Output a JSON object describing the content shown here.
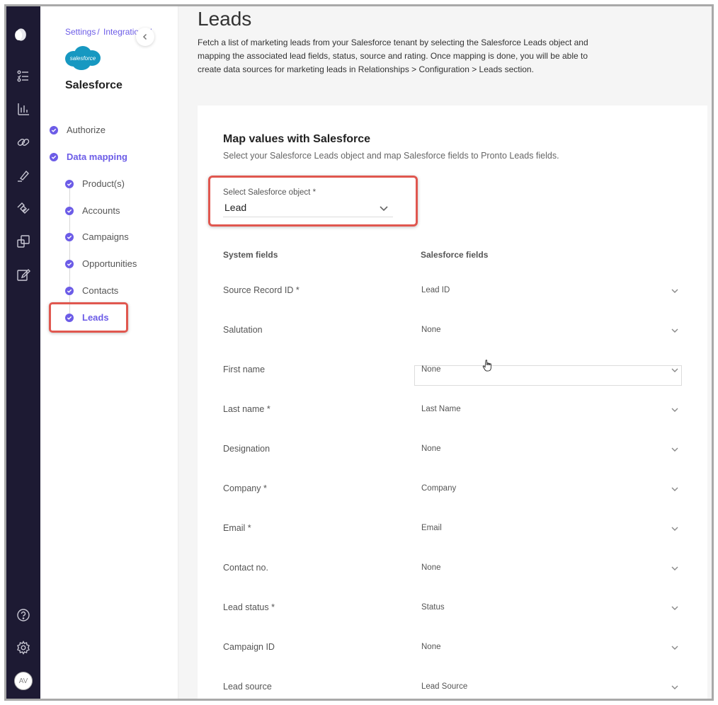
{
  "rail": {
    "icons": [
      "logo-icon",
      "checklist-icon",
      "bar-chart-icon",
      "link-icon",
      "pen-icon",
      "handshake-icon",
      "copy-icon",
      "edit-icon",
      "help-icon",
      "gear-icon"
    ],
    "avatar": "AV"
  },
  "sidebar": {
    "breadcrumb": [
      "Settings",
      "Integrations"
    ],
    "logo_text": "salesforce",
    "title": "Salesforce",
    "items": [
      {
        "label": "Authorize"
      },
      {
        "label": "Data mapping"
      },
      {
        "label": "Product(s)"
      },
      {
        "label": "Accounts"
      },
      {
        "label": "Campaigns"
      },
      {
        "label": "Opportunities"
      },
      {
        "label": "Contacts"
      },
      {
        "label": "Leads"
      }
    ],
    "active": "Leads"
  },
  "main": {
    "title": "Leads",
    "description": "Fetch a list of marketing leads from your Salesforce tenant by selecting the Salesforce Leads object and mapping the associated lead fields, status, source and rating. Once mapping is done, you will be able to create data sources for marketing leads in Relationships > Configuration > Leads section.",
    "card": {
      "title": "Map values with Salesforce",
      "subtitle": "Select your Salesforce Leads object and map Salesforce fields to Pronto Leads fields.",
      "object_label": "Select Salesforce object *",
      "object_value": "Lead",
      "col_system": "System fields",
      "col_salesforce": "Salesforce fields",
      "rows": [
        {
          "field": "Source Record ID *",
          "value": "Lead ID"
        },
        {
          "field": "Salutation",
          "value": "None"
        },
        {
          "field": "First name",
          "value": "None"
        },
        {
          "field": "Last name *",
          "value": "Last Name"
        },
        {
          "field": "Designation",
          "value": "None"
        },
        {
          "field": "Company *",
          "value": "Company"
        },
        {
          "field": "Email *",
          "value": "Email"
        },
        {
          "field": "Contact no.",
          "value": "None"
        },
        {
          "field": "Lead status *",
          "value": "Status"
        },
        {
          "field": "Campaign ID",
          "value": "None"
        },
        {
          "field": "Lead source",
          "value": "Lead Source"
        }
      ]
    }
  },
  "colors": {
    "accent": "#6c5ce7",
    "rail": "#1d1a33",
    "highlight": "#e0574f",
    "salesforce": "#1798c1"
  }
}
